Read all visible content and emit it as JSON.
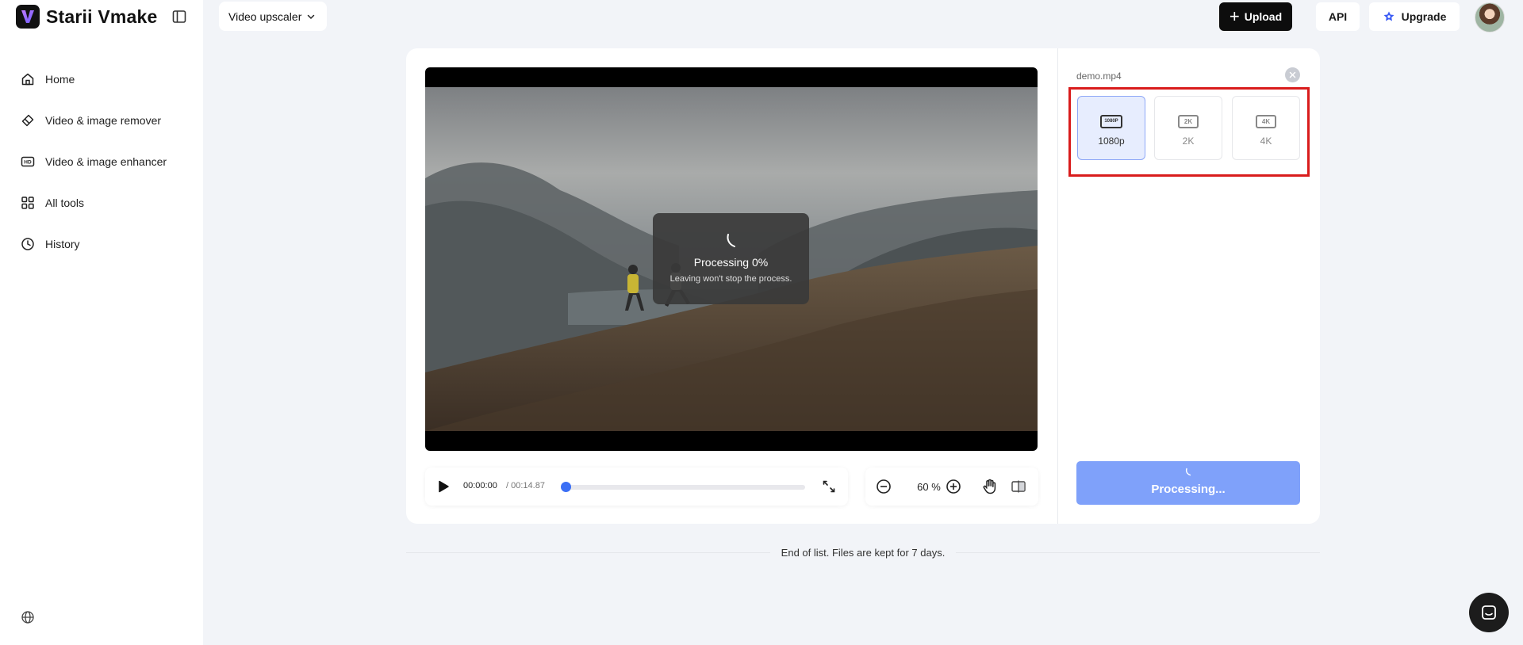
{
  "brand": {
    "name": "Starii Vmake",
    "logo_letter": "V"
  },
  "sidebar": {
    "items": [
      {
        "label": "Home",
        "icon": "home-icon"
      },
      {
        "label": "Video & image remover",
        "icon": "eraser-icon"
      },
      {
        "label": "Video & image enhancer",
        "icon": "hd-icon"
      },
      {
        "label": "All tools",
        "icon": "grid-icon"
      },
      {
        "label": "History",
        "icon": "clock-icon"
      }
    ]
  },
  "header": {
    "tool_select": "Video upscaler",
    "upload_label": "Upload",
    "api_label": "API",
    "upgrade_label": "Upgrade"
  },
  "preview": {
    "processing_title": "Processing 0%",
    "processing_sub": "Leaving won't stop the process."
  },
  "player": {
    "current_time": "00:00:00",
    "total_time": "/ 00:14.87",
    "progress": 0
  },
  "zoom": {
    "value": "60 %"
  },
  "panel": {
    "file_name": "demo.mp4",
    "resolutions": [
      {
        "badge": "1080P",
        "label": "1080p",
        "selected": true
      },
      {
        "badge": "2K",
        "label": "2K",
        "selected": false
      },
      {
        "badge": "4K",
        "label": "4K",
        "selected": false
      }
    ],
    "process_button": "Processing..."
  },
  "footer": {
    "text": "End of list. Files are kept for 7 days."
  },
  "colors": {
    "accent": "#3b6ff5",
    "button_processing": "#7fa1fa",
    "highlight": "#d91c1c"
  }
}
